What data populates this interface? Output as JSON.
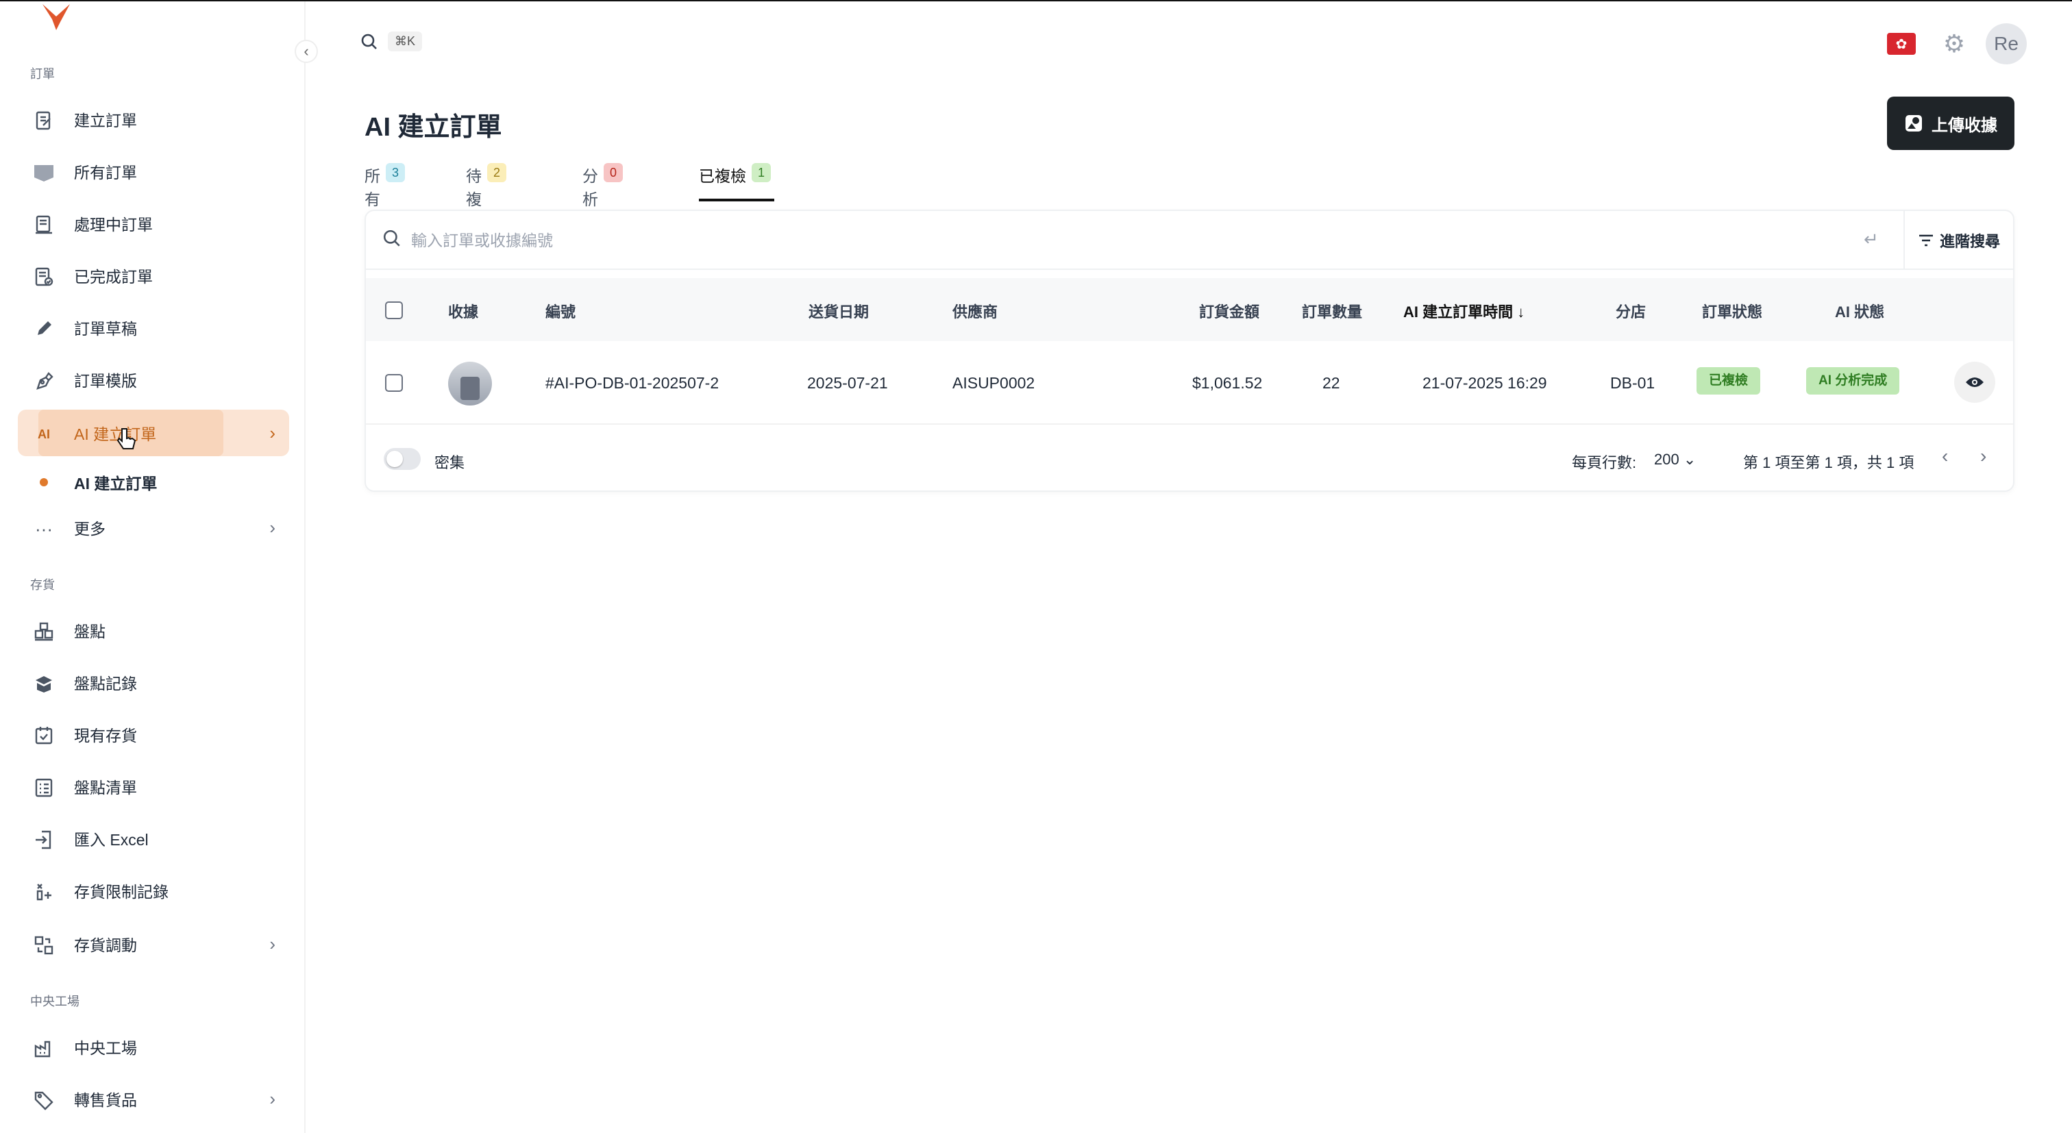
{
  "sidebar": {
    "sections": {
      "orders": "訂單",
      "inventory": "存貨",
      "central_kitchen": "中央工場"
    },
    "items": {
      "create_order": "建立訂單",
      "all_orders": "所有訂單",
      "processing_orders": "處理中訂單",
      "completed_orders": "已完成訂單",
      "order_drafts": "訂單草稿",
      "order_templates": "訂單模版",
      "ai_create_order": "AI 建立訂單",
      "ai_create_order_sub": "AI 建立訂單",
      "more": "更多",
      "stocktake": "盤點",
      "stocktake_records": "盤點記錄",
      "current_stock": "現有存貨",
      "stocktake_list": "盤點清單",
      "import_excel": "匯入 Excel",
      "stock_limit_records": "存貨限制記錄",
      "stock_transfer": "存貨調動",
      "central_kitchen": "中央工場",
      "resale_goods": "轉售貨品"
    },
    "ai_icon_text": "AI"
  },
  "header": {
    "kbd_shortcut": "⌘K",
    "avatar_initials": "Re"
  },
  "page": {
    "title": "AI 建立訂單",
    "upload_button": "上傳收據"
  },
  "tabs": [
    {
      "label": "所有",
      "count": "3",
      "color": "#cdeef6",
      "text": "#1b7f99"
    },
    {
      "label": "待複檢",
      "count": "2",
      "color": "#fbeeb8",
      "text": "#9a7a13"
    },
    {
      "label": "分析中",
      "count": "0",
      "color": "#f7c4c4",
      "text": "#b42318"
    },
    {
      "label": "已複檢",
      "count": "1",
      "color": "#cfeec4",
      "text": "#2f7d22"
    }
  ],
  "search": {
    "placeholder": "輸入訂單或收據編號",
    "advanced_label": "進階搜尋"
  },
  "table": {
    "headers": {
      "receipt": "收據",
      "number": "編號",
      "delivery_date": "送貨日期",
      "supplier": "供應商",
      "amount": "訂貨金額",
      "quantity": "訂單數量",
      "ai_created_time": "AI 建立訂單時間",
      "branch": "分店",
      "order_status": "訂單狀態",
      "ai_status": "AI 狀態"
    },
    "rows": [
      {
        "number": "#AI-PO-DB-01-202507-2",
        "delivery_date": "2025-07-21",
        "supplier": "AISUP0002",
        "amount": "$1,061.52",
        "quantity": "22",
        "ai_created_time": "21-07-2025 16:29",
        "branch": "DB-01",
        "order_status": "已複檢",
        "ai_status": "AI 分析完成"
      }
    ]
  },
  "footer": {
    "dense_label": "密集",
    "rows_per_page_label": "每頁行數:",
    "rows_per_page_value": "200",
    "range_text": "第 1 項至第 1 項，共 1 項"
  },
  "colors": {
    "accent": "#e07a2c",
    "active_bg": "#fbe4d4",
    "primary_button": "#1f2428",
    "status_green_bg": "#bfe8b4"
  }
}
